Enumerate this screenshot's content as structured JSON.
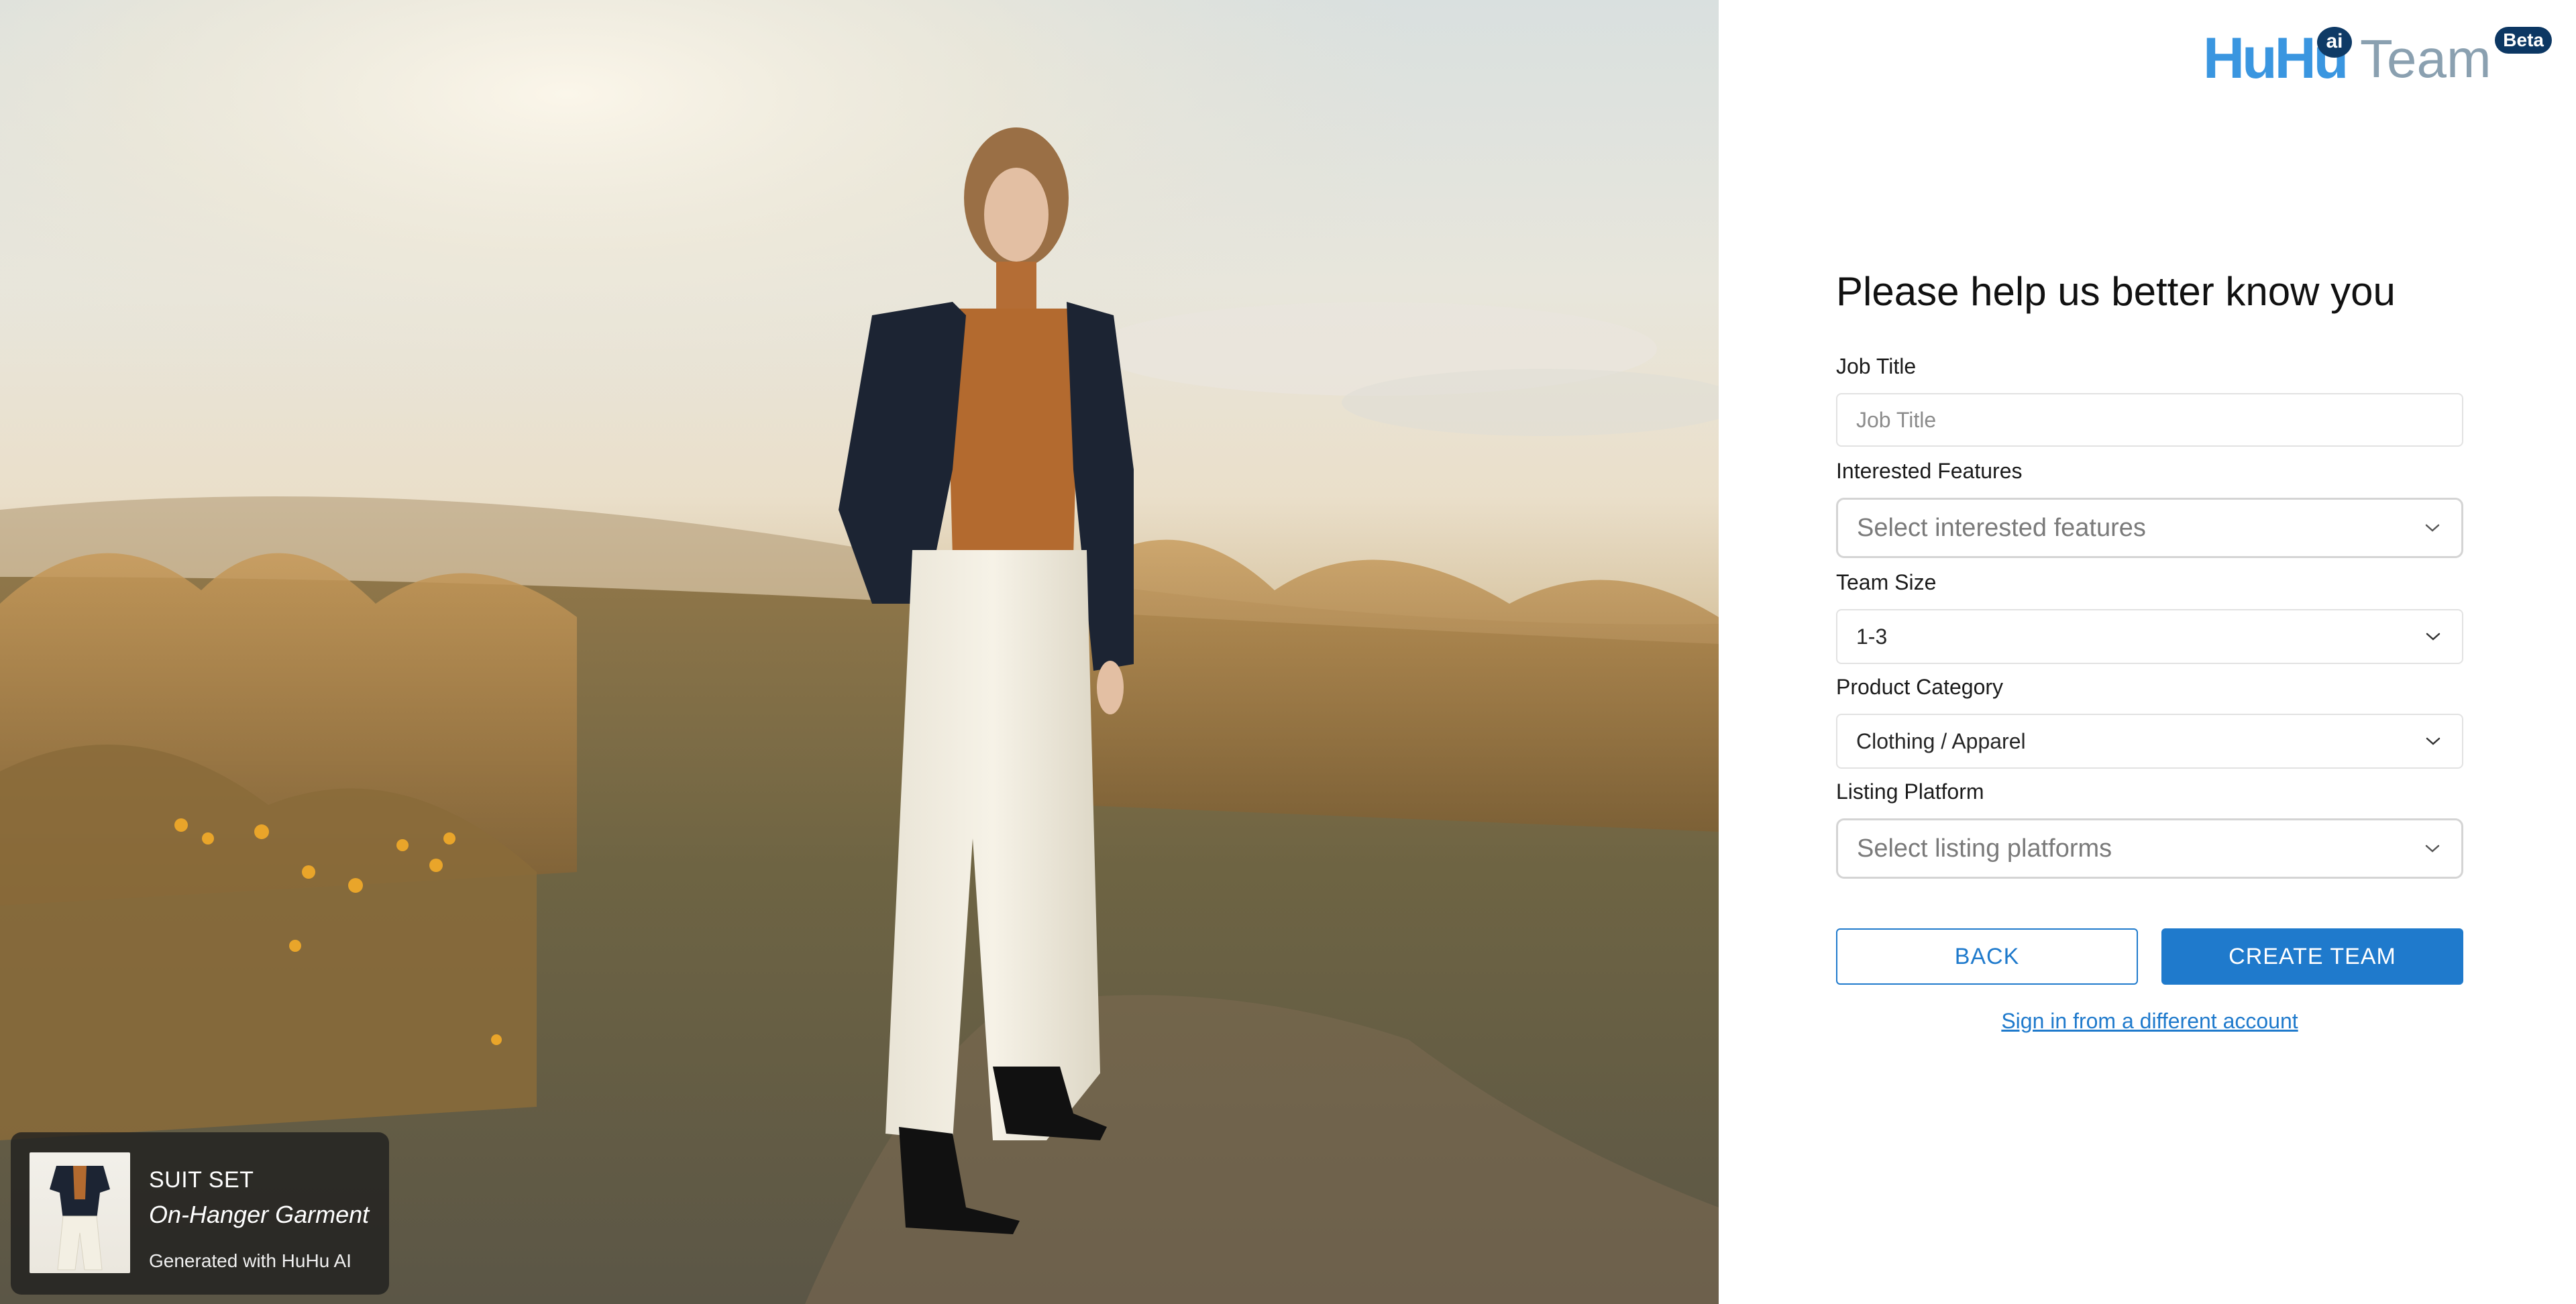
{
  "brand": {
    "logo_text": "HuHu",
    "ai_badge": "ai",
    "product_name": "Team",
    "beta_badge": "Beta"
  },
  "product_card": {
    "title": "SUIT SET",
    "subtitle": "On-Hanger Garment",
    "credit": "Generated with HuHu AI"
  },
  "form": {
    "heading": "Please help us better know you",
    "job_title": {
      "label": "Job Title",
      "placeholder": "Job Title",
      "value": ""
    },
    "interested_features": {
      "label": "Interested Features",
      "placeholder": "Select interested features"
    },
    "team_size": {
      "label": "Team Size",
      "value": "1-3"
    },
    "product_category": {
      "label": "Product Category",
      "value": "Clothing / Apparel"
    },
    "listing_platform": {
      "label": "Listing Platform",
      "placeholder": "Select listing platforms"
    },
    "back_label": "BACK",
    "create_label": "CREATE TEAM",
    "switch_account_link": "Sign in from a different account"
  },
  "colors": {
    "primary": "#1f7acc",
    "brand_blue": "#3a96e0",
    "brand_navy": "#0c3763",
    "card_bg": "#1e1e1e"
  },
  "icons": {
    "select_chevron": "chevron-down-icon"
  }
}
